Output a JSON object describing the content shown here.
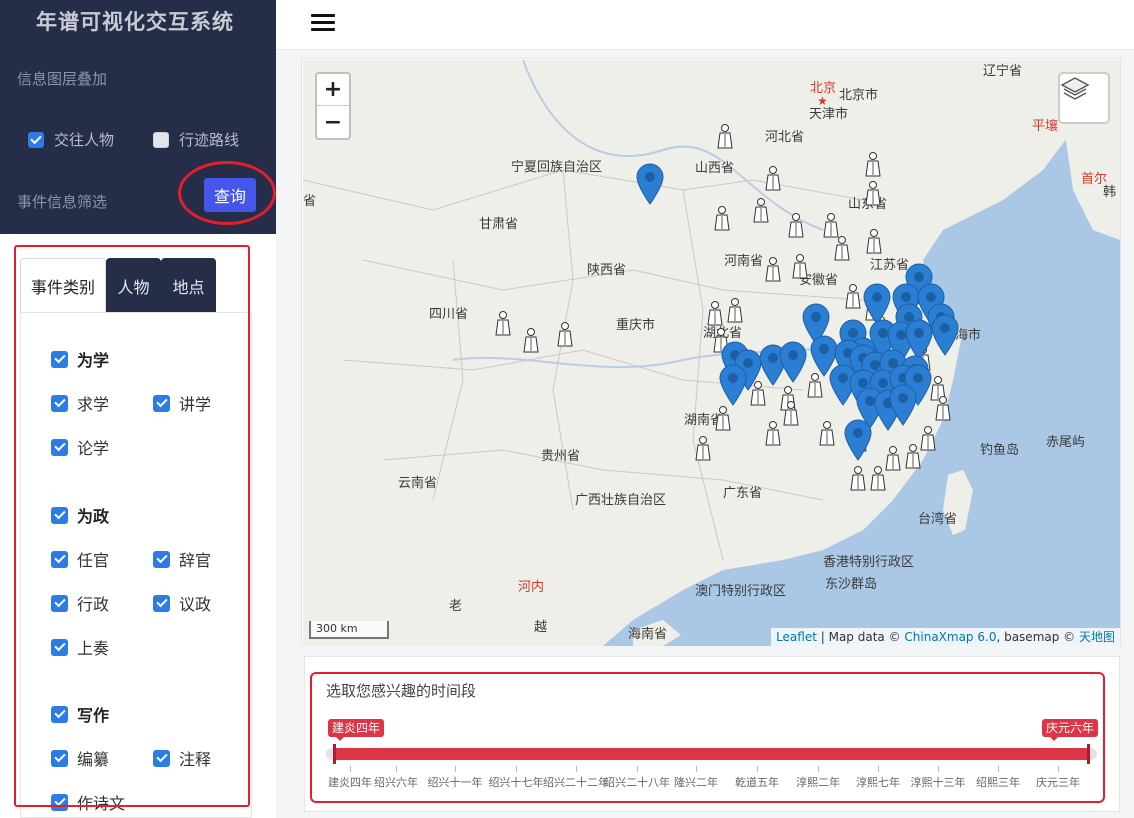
{
  "app": {
    "title": "年谱可视化交互系统"
  },
  "sidebar": {
    "layer_section_title": "信息图层叠加",
    "layers": [
      {
        "label": "交往人物",
        "checked": true
      },
      {
        "label": "行迹路线",
        "checked": false
      }
    ],
    "filter_section_title": "事件信息筛选",
    "query_button": "查询",
    "tabs": [
      {
        "label": "事件类别",
        "active": true
      },
      {
        "label": "人物",
        "active": false
      },
      {
        "label": "地点",
        "active": false
      }
    ],
    "categories": [
      {
        "label": "为学",
        "checked": true,
        "children": [
          {
            "label": "求学",
            "checked": true
          },
          {
            "label": "讲学",
            "checked": true
          },
          {
            "label": "论学",
            "checked": true
          }
        ]
      },
      {
        "label": "为政",
        "checked": true,
        "children": [
          {
            "label": "任官",
            "checked": true
          },
          {
            "label": "辞官",
            "checked": true
          },
          {
            "label": "行政",
            "checked": true
          },
          {
            "label": "议政",
            "checked": true
          },
          {
            "label": "上奏",
            "checked": true
          }
        ]
      },
      {
        "label": "写作",
        "checked": true,
        "children": [
          {
            "label": "编纂",
            "checked": true
          },
          {
            "label": "注释",
            "checked": true
          },
          {
            "label": "作诗文",
            "checked": true
          }
        ]
      }
    ]
  },
  "map": {
    "zoom_in": "+",
    "zoom_out": "−",
    "scale": "300 km",
    "attribution": {
      "leaflet": "Leaflet",
      "mid": " | Map data © ",
      "data": "ChinaXmap 6.0",
      "mid2": ", basemap © ",
      "base": "天地图"
    },
    "labels": {
      "liaoning": "辽宁省",
      "beijing": "北京",
      "beijing_city": "北京市",
      "tianjin": "天津市",
      "hebei": "河北省",
      "pyongyang": "平壤",
      "seoul": "首尔",
      "korea": "韩",
      "ningxia": "宁夏回族自治区",
      "shanxi": "山西省",
      "shandong": "山东省",
      "gansu": "甘肃省",
      "sheng_edge": "省",
      "henan": "河南省",
      "jiangsu": "江苏省",
      "shaanxi": "陕西省",
      "anhui": "安徽省",
      "sichuan": "四川省",
      "chongqing": "重庆市",
      "hubei": "湖北省",
      "shanghai": "海市",
      "hunan": "湖南省",
      "guizhou": "贵州省",
      "diaoyu": "钓鱼岛",
      "chiwei": "赤尾屿",
      "yunnan": "云南省",
      "guangxi": "广西壮族自治区",
      "guangdong": "广东省",
      "taiwan": "台湾省",
      "hongkong": "香港特别行政区",
      "macau": "澳门特别行政区",
      "dongsha": "东沙群岛",
      "hanoi": "河内",
      "laos": "老",
      "vietnam": "越",
      "hainan": "海南省"
    }
  },
  "timeline": {
    "title": "选取您感兴趣的时间段",
    "start_label": "建炎四年",
    "end_label": "庆元六年",
    "ticks": [
      "建炎四年",
      "绍兴六年",
      "绍兴十一年",
      "绍兴十七年",
      "绍兴二十二年",
      "绍兴二十八年",
      "隆兴二年",
      "乾道五年",
      "淳熙二年",
      "淳熙七年",
      "淳熙十三年",
      "绍熙三年",
      "庆元三年"
    ]
  }
}
